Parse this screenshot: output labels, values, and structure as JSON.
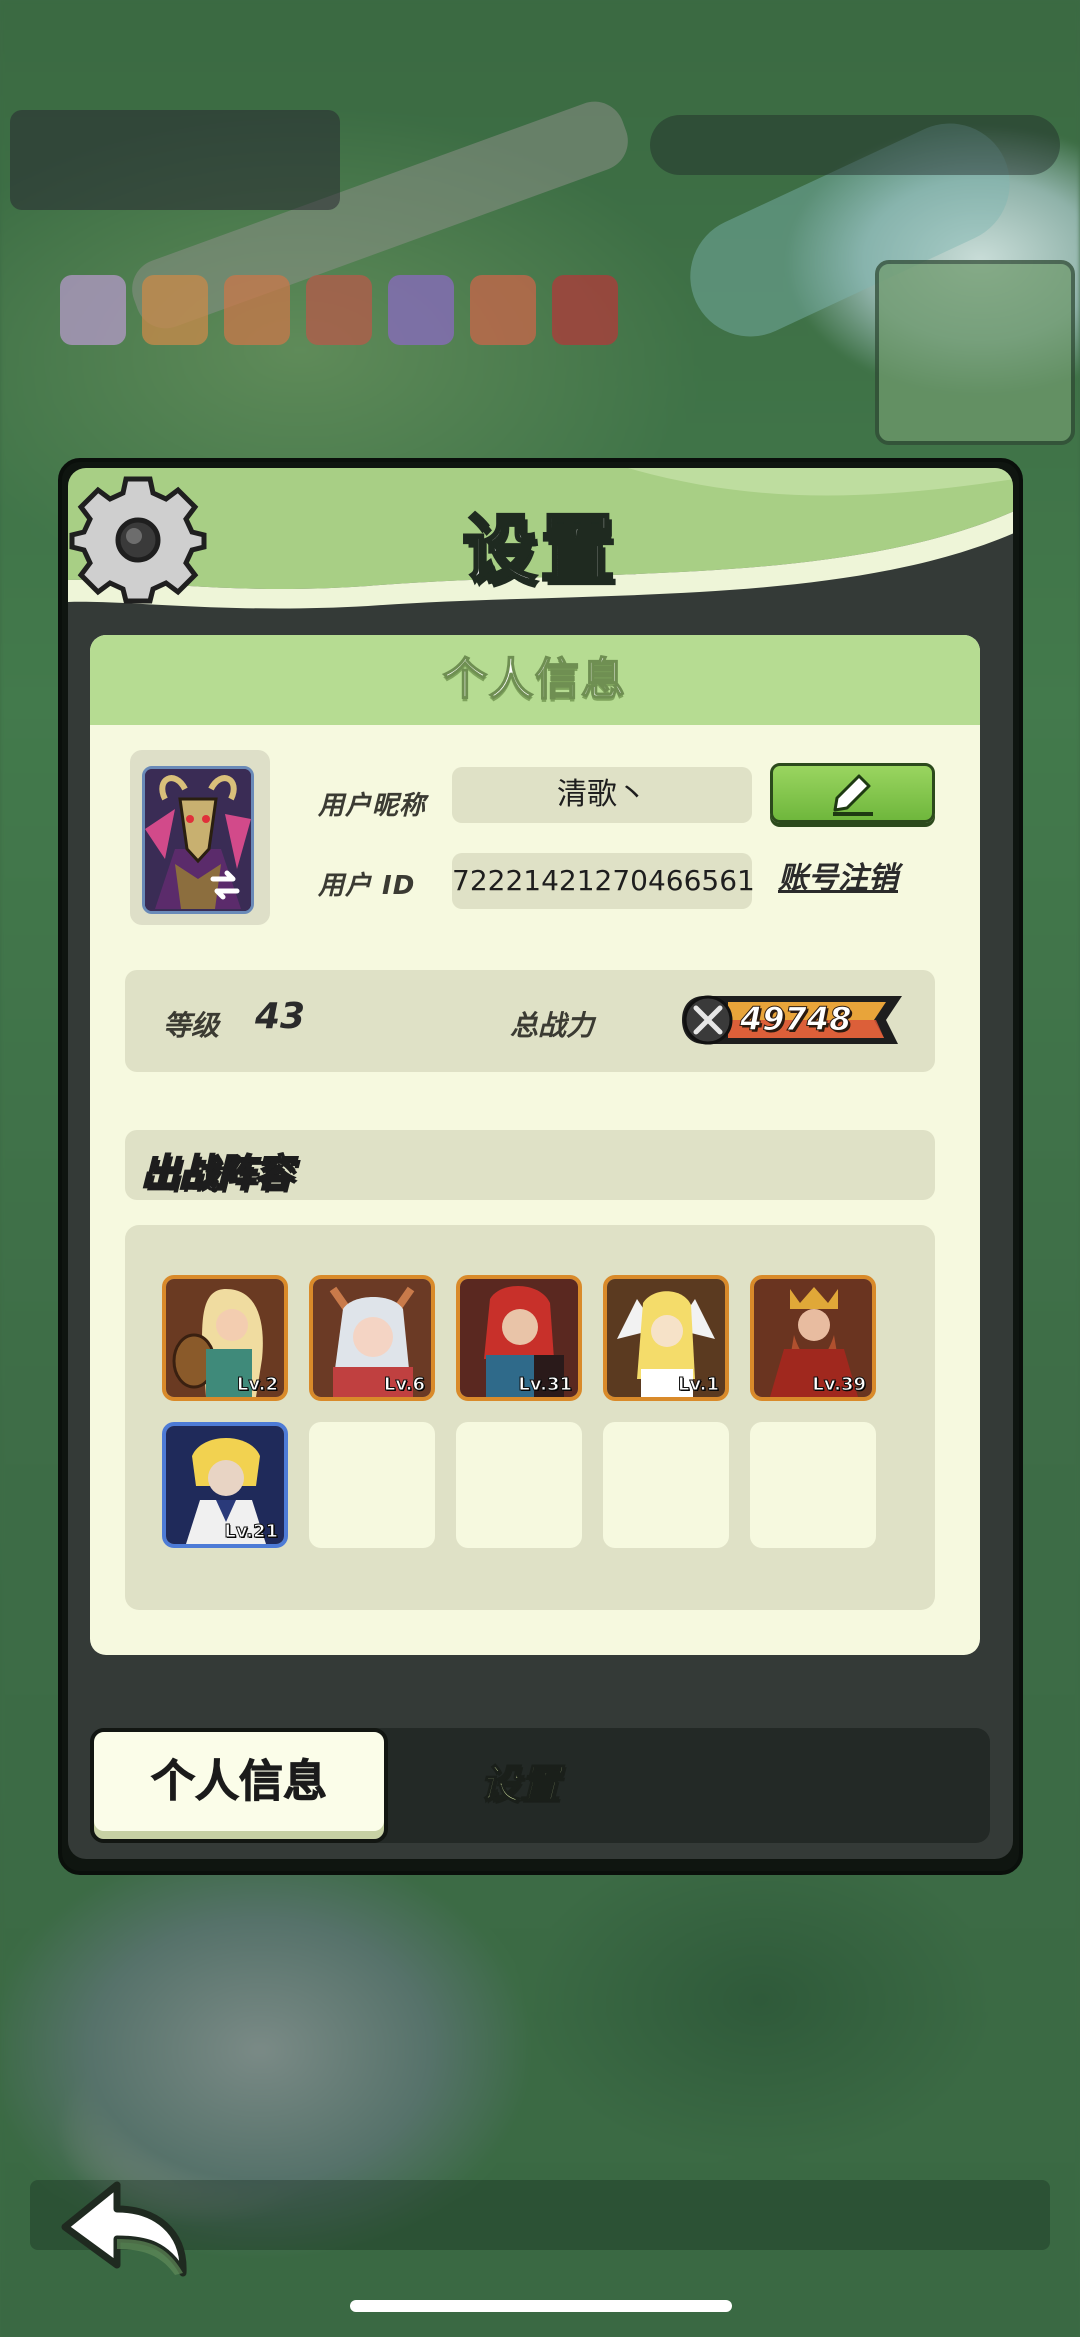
{
  "dialog": {
    "title": "设置",
    "section_title": "个人信息"
  },
  "profile": {
    "nickname_label": "用户昵称",
    "nickname_value": "清歌丶",
    "id_label": "用户  ID",
    "id_value": "72221421270466561",
    "logout_label": "账号注销",
    "edit_icon": "pencil-icon"
  },
  "stats": {
    "level_label": "等级",
    "level_value": "43",
    "power_label": "总战力",
    "power_value": "49748"
  },
  "lineup": {
    "title": "出战阵容",
    "heroes": [
      {
        "level": "Lv.2"
      },
      {
        "level": "Lv.6"
      },
      {
        "level": "Lv.31"
      },
      {
        "level": "Lv.1"
      },
      {
        "level": "Lv.39"
      },
      {
        "level": "Lv.21"
      }
    ],
    "empty_slots": 4
  },
  "tabs": [
    {
      "label": "个人信息",
      "active": true
    },
    {
      "label": "设置",
      "active": false
    }
  ],
  "colors": {
    "header_green": "#b6dc92",
    "card_bg": "#f6f9df",
    "hero_border_orange": "#d98a2a",
    "hero_border_blue": "#4d7bd6"
  }
}
